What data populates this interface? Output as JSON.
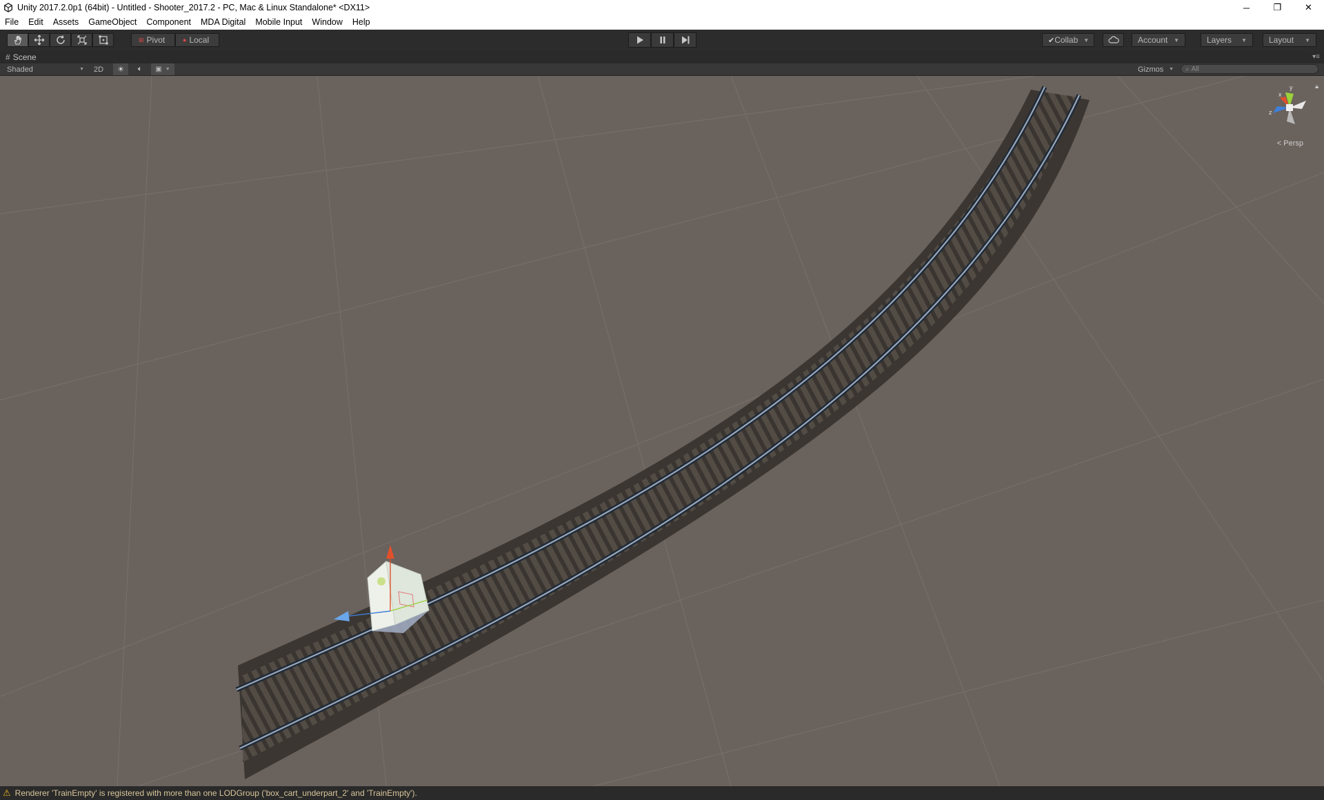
{
  "window": {
    "title": "Unity 2017.2.0p1 (64bit) - Untitled - Shooter_2017.2 - PC, Mac & Linux Standalone* <DX11>",
    "controls": {
      "minimize": "─",
      "restore": "❐",
      "close": "✕"
    }
  },
  "menu": {
    "items": [
      "File",
      "Edit",
      "Assets",
      "GameObject",
      "Component",
      "MDA Digital",
      "Mobile Input",
      "Window",
      "Help"
    ]
  },
  "toolbar": {
    "pivot_label": "Pivot",
    "local_label": "Local",
    "collab_label": "Collab",
    "account_label": "Account",
    "layers_label": "Layers",
    "layout_label": "Layout"
  },
  "scene_panel": {
    "tab_label": "Scene",
    "shading_mode": "Shaded",
    "mode_2d": "2D",
    "gizmos_label": "Gizmos",
    "search_placeholder": "All",
    "projection_label": "Persp",
    "axis_labels": {
      "x": "x",
      "y": "y",
      "z": "z"
    }
  },
  "status": {
    "message": "Renderer 'TrainEmpty' is registered with more than one LODGroup ('box_cart_underpart_2' and 'TrainEmpty')."
  },
  "colors": {
    "ground": "#6a625d",
    "toolbar": "#2c2c2c",
    "warning": "#e6b31e",
    "axis_x": "#e0502c",
    "axis_y": "#9bd13a",
    "axis_z": "#3f7fd8"
  }
}
